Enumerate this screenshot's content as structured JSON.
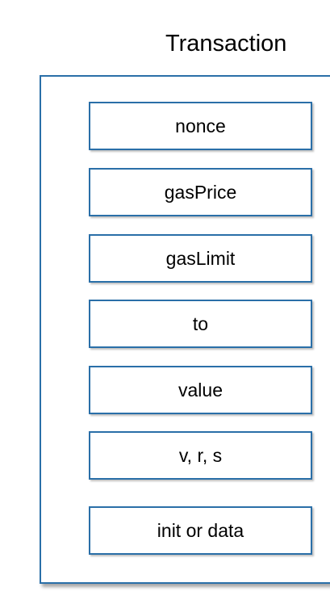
{
  "diagram": {
    "title": "Transaction",
    "fields": [
      {
        "label": "nonce"
      },
      {
        "label": "gasPrice"
      },
      {
        "label": "gasLimit"
      },
      {
        "label": "to"
      },
      {
        "label": "value"
      },
      {
        "label": "v, r, s"
      },
      {
        "label": "init or data"
      }
    ],
    "colors": {
      "border": "#2a6fa8",
      "text": "#000000",
      "background": "#ffffff"
    }
  }
}
